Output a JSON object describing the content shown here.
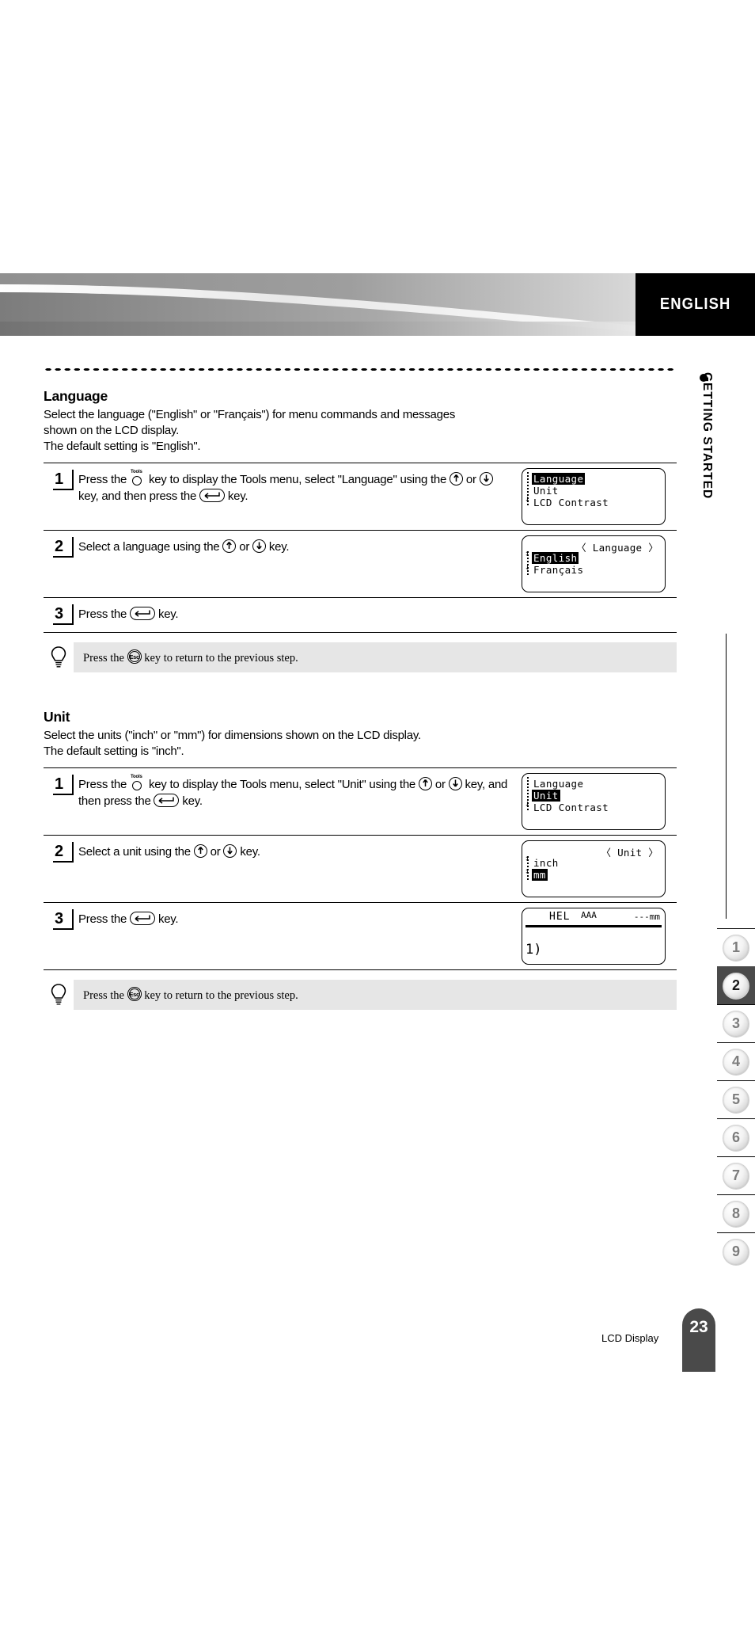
{
  "banner": {
    "language_tag": "ENGLISH"
  },
  "side_chapter": {
    "label": "GETTING STARTED",
    "bullet": "bullet-dot"
  },
  "sections": [
    {
      "title": "Language",
      "desc_line1": "Select the language (\"English\" or \"Français\") for menu commands and messages",
      "desc_line2": "shown on the LCD display.",
      "desc_line3": "The default setting is \"English\".",
      "steps": [
        {
          "num": "1",
          "text_a": "Press the ",
          "icon_a": "tools-key-icon",
          "text_b": " key to display the Tools menu, select \"Language\" using the ",
          "icon_b": "up-arrow-key-icon",
          "text_c": " or ",
          "icon_c": "down-arrow-key-icon",
          "text_d": " key, and then press the ",
          "icon_d": "enter-key-icon",
          "text_e": " key.",
          "lcd": {
            "kind": "menu-list",
            "rows": [
              "Language",
              "Unit",
              "LCD Contrast"
            ],
            "selected_index": 0,
            "scroll_down_arrow": "↓"
          }
        },
        {
          "num": "2",
          "text_a": "Select a language using the ",
          "icon_b": "up-arrow-key-icon",
          "text_c": " or ",
          "icon_c": "down-arrow-key-icon",
          "text_e": " key.",
          "lcd": {
            "kind": "menu-titled",
            "header": "〈 Language 〉",
            "rows": [
              "English",
              "Français"
            ],
            "selected_index": 0,
            "scroll_up_arrow": "↕",
            "scroll_down_arrow": "↓"
          }
        },
        {
          "num": "3",
          "text_a": "Press the ",
          "icon_d": "enter-key-icon",
          "text_e": " key.",
          "lcd": null
        }
      ],
      "tip": {
        "icon": "lightbulb-icon",
        "text_a": "Press the ",
        "icon_key": "esc-key-icon",
        "text_b": " key to return to the previous step."
      }
    },
    {
      "title": "Unit",
      "desc_line1": "Select the units (\"inch\" or \"mm\") for dimensions shown on the LCD display.",
      "desc_line2": "The default setting is \"inch\".",
      "desc_line3": "",
      "steps": [
        {
          "num": "1",
          "text_a": "Press the ",
          "icon_a": "tools-key-icon",
          "text_b": " key to display the Tools menu, select \"Unit\" using the ",
          "icon_b": "up-arrow-key-icon",
          "text_c": " or ",
          "icon_c": "down-arrow-key-icon",
          "text_d": " key, and then press the ",
          "icon_d": "enter-key-icon",
          "text_e": " key.",
          "lcd": {
            "kind": "menu-list",
            "rows": [
              "Language",
              "Unit",
              "LCD Contrast"
            ],
            "selected_index": 1,
            "scroll_down_arrow": "↓"
          }
        },
        {
          "num": "2",
          "text_a": "Select a unit using the ",
          "icon_b": "up-arrow-key-icon",
          "text_c": " or ",
          "icon_c": "down-arrow-key-icon",
          "text_e": " key.",
          "lcd": {
            "kind": "menu-titled",
            "header": "〈 Unit 〉",
            "rows": [
              "inch",
              "mm"
            ],
            "selected_index": 1,
            "scroll_up_arrow": "↕",
            "scroll_down_arrow": "↕"
          }
        },
        {
          "num": "3",
          "text_a": "Press the ",
          "icon_d": "enter-key-icon",
          "text_e": " key.",
          "lcd": {
            "kind": "editor",
            "font_label": "HEL",
            "size_label": "AAA",
            "length_label": "---mm",
            "cursor": "1)"
          }
        }
      ],
      "tip": {
        "icon": "lightbulb-icon",
        "text_a": "Press the ",
        "icon_key": "esc-key-icon",
        "text_b": " key to return to the previous step."
      }
    }
  ],
  "chapter_index": {
    "items": [
      "1",
      "2",
      "3",
      "4",
      "5",
      "6",
      "7",
      "8",
      "9"
    ],
    "active": "2"
  },
  "footer": {
    "label": "LCD Display",
    "page_number": "23"
  },
  "colors": {
    "accent_dark": "#4a4a4a",
    "tip_bg": "#e6e6e6",
    "banner_tag_bg": "#000000"
  }
}
